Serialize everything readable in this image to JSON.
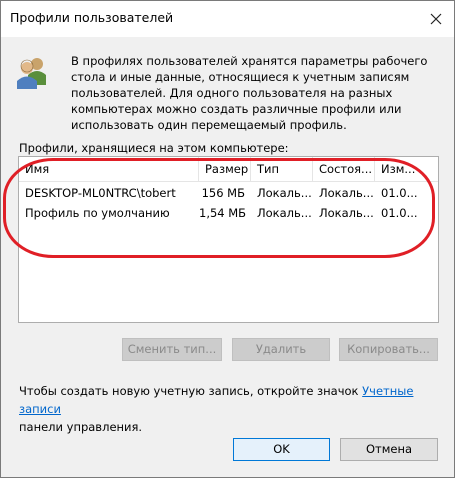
{
  "window": {
    "title": "Профили пользователей",
    "close_glyph": "✕"
  },
  "description": "В профилях пользователей хранятся параметры рабочего стола и иные данные, относящиеся к учетным записям пользователей. Для одного пользователя на разных компьютерах можно создать различные профили или использовать один перемещаемый профиль.",
  "list_caption": "Профили, хранящиеся на этом компьютере:",
  "table": {
    "columns": [
      "Имя",
      "Размер",
      "Тип",
      "Состоя...",
      "Изм..."
    ],
    "rows": [
      [
        "DESKTOP-ML0NTRC\\tobert",
        "156 МБ",
        "Локаль...",
        "Локаль...",
        "01.0..."
      ],
      [
        "Профиль по умолчанию",
        "1,54 МБ",
        "Локаль...",
        "Локаль...",
        "01.0..."
      ]
    ]
  },
  "buttons": {
    "change_type": "Сменить тип...",
    "delete": "Удалить",
    "copy": "Копировать...",
    "ok": "OK",
    "cancel": "Отмена"
  },
  "footer": {
    "text_before": "Чтобы создать новую учетную запись, откройте значок ",
    "link": "Учетные записи",
    "text_after": "панели управления."
  },
  "colors": {
    "highlight": "#e01f26",
    "link": "#0066cc"
  },
  "icons": {
    "users": "users-icon",
    "close": "close-icon"
  }
}
